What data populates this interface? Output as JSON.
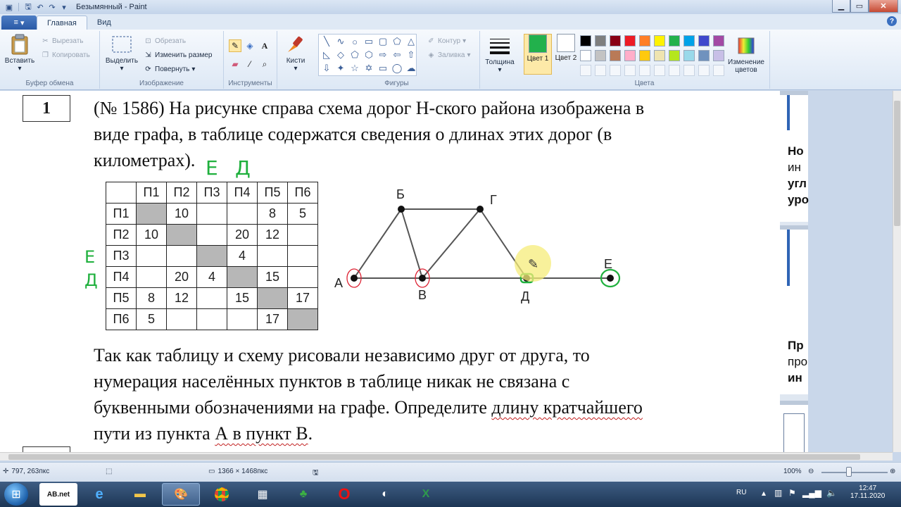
{
  "window": {
    "title": "Безымянный - Paint"
  },
  "menu": {
    "app_button": "≡",
    "tabs": [
      "Главная",
      "Вид"
    ]
  },
  "ribbon": {
    "clipboard": {
      "group_label": "Буфер обмена",
      "paste": "Вставить",
      "cut": "Вырезать",
      "copy": "Копировать"
    },
    "image": {
      "group_label": "Изображение",
      "select": "Выделить",
      "crop": "Обрезать",
      "resize": "Изменить размер",
      "rotate": "Повернуть"
    },
    "tools": {
      "group_label": "Инструменты"
    },
    "brushes": {
      "label": "Кисти"
    },
    "shapes": {
      "group_label": "Фигуры",
      "outline": "Контур",
      "fill": "Заливка"
    },
    "size": {
      "label": "Толщина"
    },
    "colors": {
      "group_label": "Цвета",
      "color1": "Цвет 1",
      "color2": "Цвет 2",
      "edit": "Изменение цветов",
      "color1_value": "#22b14c",
      "color2_value": "#ffffff",
      "palette_row1": [
        "#000000",
        "#7f7f7f",
        "#880015",
        "#ed1c24",
        "#ff7f27",
        "#fff200",
        "#22b14c",
        "#00a2e8",
        "#3f48cc",
        "#a349a4"
      ],
      "palette_row2": [
        "#ffffff",
        "#c3c3c3",
        "#b97a57",
        "#ffaec9",
        "#ffc90e",
        "#efe4b0",
        "#b5e61d",
        "#99d9ea",
        "#7092be",
        "#c8bfe7"
      ]
    }
  },
  "document": {
    "task_number": "1",
    "paragraph1": [
      "(№ 1586) На рисунке справа схема дорог Н-ского района изображена в",
      "виде графа, в таблице содержатся сведения о длинах этих дорог (в",
      "километрах)."
    ],
    "table": {
      "header": [
        "",
        "П1",
        "П2",
        "П3",
        "П4",
        "П5",
        "П6"
      ],
      "rows": [
        [
          "П1",
          "",
          "10",
          "",
          "",
          "8",
          "5"
        ],
        [
          "П2",
          "10",
          "",
          "",
          "20",
          "12",
          ""
        ],
        [
          "П3",
          "",
          "",
          "",
          "4",
          "",
          ""
        ],
        [
          "П4",
          "",
          "20",
          "4",
          "",
          "15",
          ""
        ],
        [
          "П5",
          "8",
          "12",
          "",
          "15",
          "",
          "17"
        ],
        [
          "П6",
          "5",
          "",
          "",
          "",
          "17",
          ""
        ]
      ]
    },
    "graph": {
      "vertices": [
        "А",
        "Б",
        "В",
        "Г",
        "Д",
        "Е"
      ],
      "edges": [
        [
          "А",
          "Б"
        ],
        [
          "Б",
          "В"
        ],
        [
          "Б",
          "Г"
        ],
        [
          "В",
          "Г"
        ],
        [
          "Г",
          "Д"
        ],
        [
          "А",
          "В"
        ],
        [
          "В",
          "Д"
        ],
        [
          "Д",
          "Е"
        ]
      ]
    },
    "handwritten_annotations": [
      "Е",
      "Д",
      "Е",
      "Д"
    ],
    "paragraph2_lines": [
      "Так как таблицу и схему рисовали независимо друг от друга, то",
      "нумерация населённых пунктов в таблице никак не связана с"
    ],
    "paragraph2_line3_plain": "буквенными обозначениями на графе. Определите ",
    "paragraph2_line3_underlined": "длину кратчайшего",
    "paragraph2_line4_plain": "пути из пункта ",
    "paragraph2_line4_underlined": "А в пункт В",
    "paragraph2_line4_end": ".",
    "side_fragments": [
      {
        "lines": [
          "Но",
          "ин",
          "угл",
          "уро"
        ]
      },
      {
        "lines": [
          "Пр",
          "про",
          "ин"
        ]
      }
    ]
  },
  "statusbar": {
    "cursor_pos": "797, 263пкс",
    "image_size": "1366 × 1468пкс",
    "zoom": "100%",
    "zoom_fraction": 0.42
  },
  "taskbar": {
    "language": "RU",
    "time": "12:47",
    "date": "17.11.2020"
  }
}
